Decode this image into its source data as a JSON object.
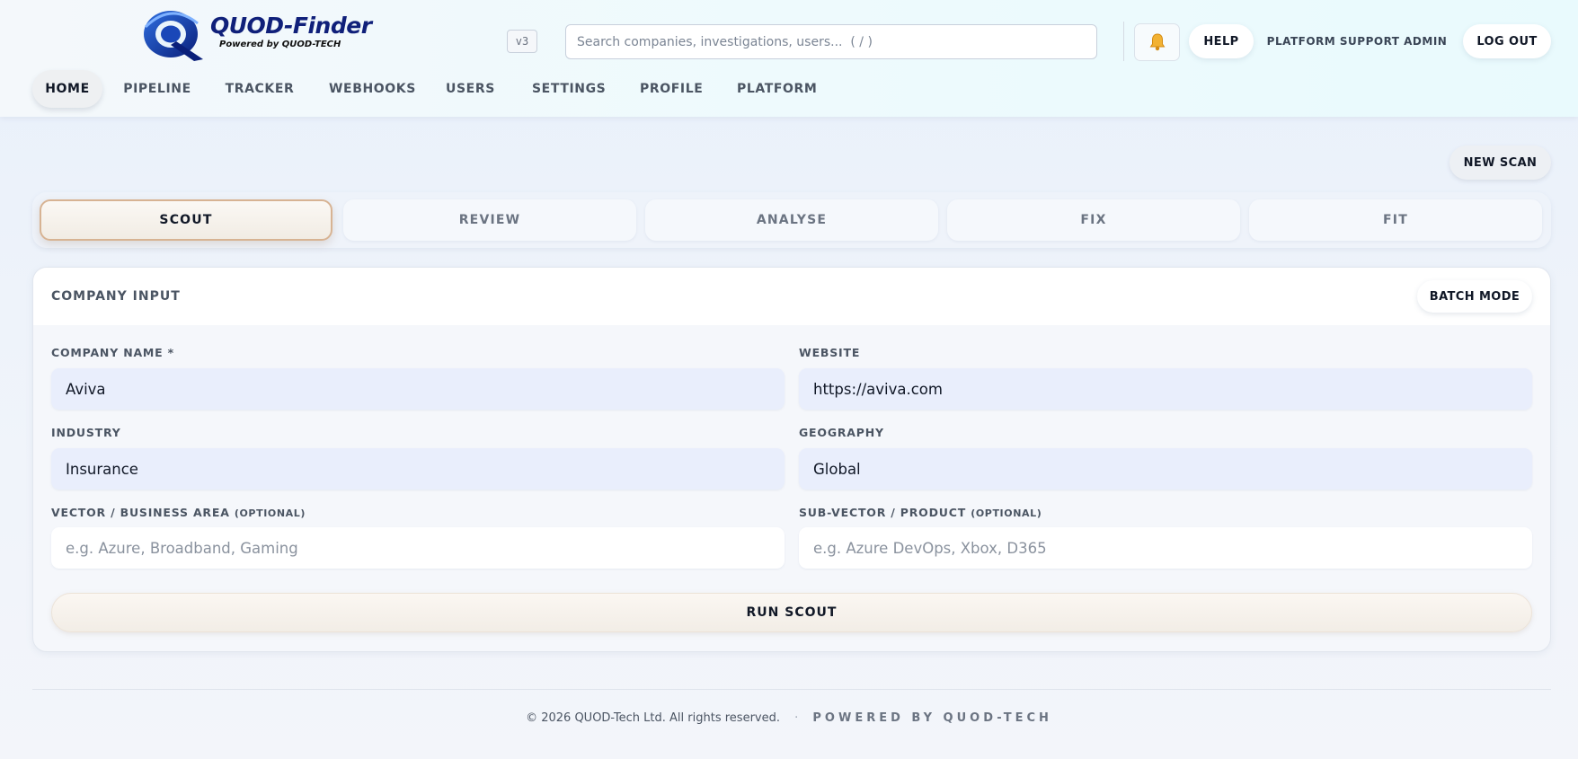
{
  "header": {
    "logo_title": "QUOD-Finder",
    "logo_subtitle": "Powered by QUOD-TECH",
    "version": "v3",
    "search_placeholder": "Search companies, investigations, users...  ( / )",
    "help_label": "HELP",
    "user_label": "PLATFORM SUPPORT ADMIN",
    "logout_label": "LOG OUT",
    "bell_icon": "bell-icon"
  },
  "nav": {
    "items": [
      {
        "label": "HOME",
        "active": true
      },
      {
        "label": "PIPELINE"
      },
      {
        "label": "TRACKER"
      },
      {
        "label": "WEBHOOKS"
      },
      {
        "label": "USERS"
      },
      {
        "label": "SETTINGS"
      },
      {
        "label": "PROFILE"
      },
      {
        "label": "PLATFORM"
      }
    ]
  },
  "actions": {
    "new_scan_label": "NEW SCAN"
  },
  "steps": [
    {
      "label": "SCOUT",
      "active": true
    },
    {
      "label": "REVIEW"
    },
    {
      "label": "ANALYSE"
    },
    {
      "label": "FIX"
    },
    {
      "label": "FIT"
    }
  ],
  "form": {
    "title": "COMPANY INPUT",
    "batch_label": "BATCH MODE",
    "company_name": {
      "label": "COMPANY NAME *",
      "value": "Aviva"
    },
    "website": {
      "label": "WEBSITE",
      "value": "https://aviva.com"
    },
    "industry": {
      "label": "INDUSTRY",
      "value": "Insurance"
    },
    "geography": {
      "label": "GEOGRAPHY",
      "value": "Global"
    },
    "vector": {
      "label": "VECTOR / BUSINESS AREA",
      "optional": "(OPTIONAL)",
      "placeholder": "e.g. Azure, Broadband, Gaming"
    },
    "subvector": {
      "label": "SUB-VECTOR / PRODUCT",
      "optional": "(OPTIONAL)",
      "placeholder": "e.g. Azure DevOps, Xbox, D365"
    },
    "run_label": "RUN SCOUT"
  },
  "footer": {
    "copyright": "© 2026 QUOD-Tech Ltd. All rights reserved.",
    "separator": "·",
    "powered": "POWERED BY QUOD-TECH"
  },
  "colors": {
    "brand_navy": "#10207a",
    "active_step_border": "#d7b393",
    "input_fill": "#e9eefc"
  }
}
